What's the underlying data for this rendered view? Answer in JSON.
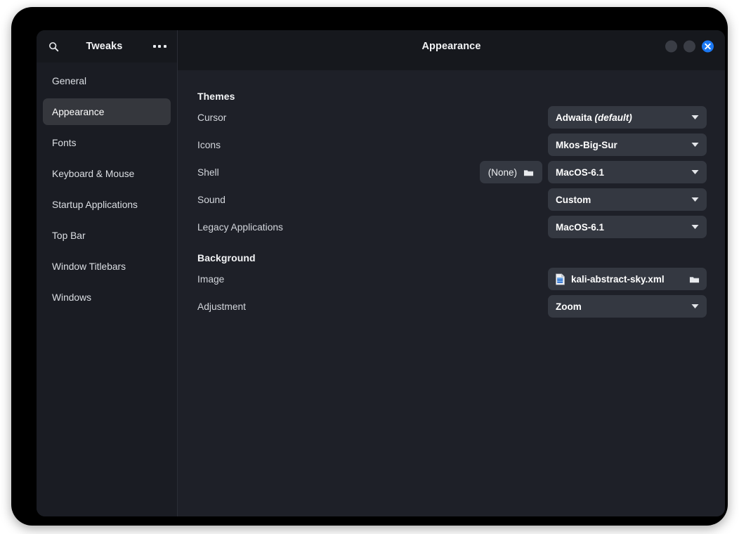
{
  "window": {
    "sidebar_header_title": "Tweaks",
    "content_header_title": "Appearance",
    "search_icon": "search-icon",
    "menu_icon": "three-dots-menu-icon",
    "controls": {
      "minimize_label": "minimize",
      "maximize_label": "maximize",
      "close_label": "close",
      "close_color": "#1b78f2",
      "button_color": "#3a3d45"
    }
  },
  "sidebar": {
    "items": [
      {
        "label": "General",
        "selected": false
      },
      {
        "label": "Appearance",
        "selected": true
      },
      {
        "label": "Fonts",
        "selected": false
      },
      {
        "label": "Keyboard & Mouse",
        "selected": false
      },
      {
        "label": "Startup Applications",
        "selected": false
      },
      {
        "label": "Top Bar",
        "selected": false
      },
      {
        "label": "Window Titlebars",
        "selected": false
      },
      {
        "label": "Windows",
        "selected": false
      }
    ]
  },
  "content": {
    "groups": [
      {
        "title": "Themes",
        "rows": [
          {
            "label": "Cursor",
            "control": "combo",
            "value": "Adwaita",
            "value_italic": "(default)",
            "caret_icon": "chevron-down-icon"
          },
          {
            "label": "Icons",
            "control": "combo",
            "value": "Mkos-Big-Sur",
            "caret_icon": "chevron-down-icon"
          },
          {
            "label": "Shell",
            "control": "combo-with-file",
            "file_button_label": "(None)",
            "file_button_icon": "folder-icon",
            "value": "MacOS-6.1",
            "caret_icon": "chevron-down-icon"
          },
          {
            "label": "Sound",
            "control": "combo",
            "value": "Custom",
            "caret_icon": "chevron-down-icon"
          },
          {
            "label": "Legacy Applications",
            "control": "combo",
            "value": "MacOS-6.1",
            "caret_icon": "chevron-down-icon"
          }
        ]
      },
      {
        "title": "Background",
        "rows": [
          {
            "label": "Image",
            "control": "filechooser",
            "value": "kali-abstract-sky.xml",
            "file_icon": "xml-document-icon",
            "folder_icon": "folder-icon"
          },
          {
            "label": "Adjustment",
            "control": "combo",
            "value": "Zoom",
            "caret_icon": "chevron-down-icon"
          }
        ]
      }
    ]
  },
  "theme": {
    "page_background": "#ffffff",
    "frame": "#000000",
    "window_background": "#1e2028",
    "headerbar": "#16181d",
    "sidebar": "#1a1c23",
    "sidebar_selected": "#35373d",
    "control_background": "#343841",
    "text_primary": "#ffffff",
    "text_secondary": "#d3d6dc",
    "divider": "#2a2d35"
  }
}
